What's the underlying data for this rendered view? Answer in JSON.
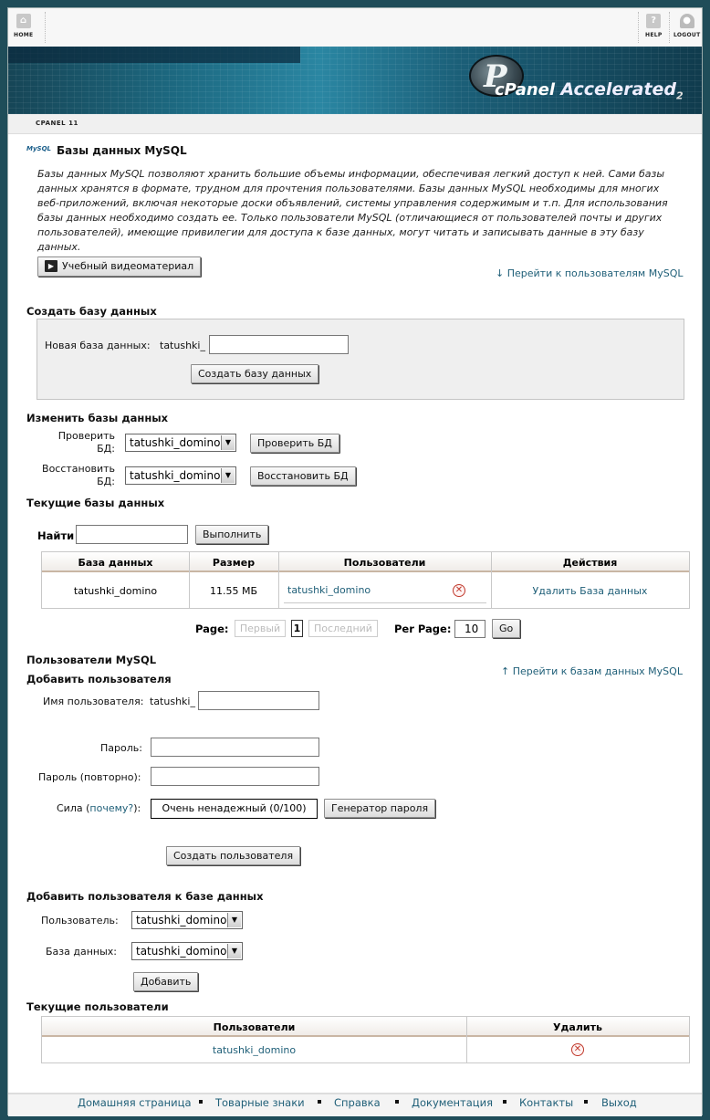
{
  "toolbar": {
    "home": "HOME",
    "help": "HELP",
    "logout": "LOGOUT"
  },
  "banner": {
    "logo_letter": "P",
    "brand": "cPanel",
    "brand_suffix": "Accelerated",
    "version": "2"
  },
  "breadcrumb": "CPANEL 11",
  "page": {
    "icon": "MySQL",
    "title": "Базы данных MySQL",
    "description_lines": [
      "Базы данных MySQL позволяют хранить большие объемы информации, обеспечивая легкий доступ к ней. Сами базы",
      "данных хранятся в формате, трудном для прочтения пользователями. Базы данных MySQL необходимы для многих",
      "веб-приложений, включая некоторые доски объявлений, системы управления содержимым и т.п. Для использования",
      "базы данных необходимо создать ее. Только пользователи MySQL (отличающиеся от пользователей почты и других",
      "пользователей), имеющие привилегии для доступа к базе данных, могут читать и записывать данные в эту базу",
      "данных."
    ],
    "video_button": "Учебный видеоматериал",
    "jump_users_link": "Перейти к пользователям MySQL"
  },
  "create_db": {
    "heading": "Создать базу данных",
    "label": "Новая база данных:",
    "prefix": "tatushki_",
    "value": "",
    "button": "Создать базу данных"
  },
  "modify_db": {
    "heading": "Изменить базы данных",
    "check_label_1": "Проверить",
    "check_label_2": "БД:",
    "check_select": "tatushki_domino",
    "check_button": "Проверить БД",
    "repair_label_1": "Восстановить",
    "repair_label_2": "БД:",
    "repair_select": "tatushki_domino",
    "repair_button": "Восстановить БД"
  },
  "current_db": {
    "heading": "Текущие базы данных",
    "search_label": "Найти",
    "search_value": "",
    "search_button": "Выполнить",
    "columns": [
      "База данных",
      "Размер",
      "Пользователи",
      "Действия"
    ],
    "rows": [
      {
        "database": "tatushki_domino",
        "size": "11.55 МБ",
        "user": "tatushki_domino",
        "action": "Удалить База данных"
      }
    ],
    "pagination": {
      "page_label": "Page:",
      "first": "Первый",
      "current": "1",
      "last": "Последний",
      "per_page_label": "Per Page:",
      "per_page": "10",
      "go": "Go"
    }
  },
  "mysql_users": {
    "heading": "Пользователи MySQL",
    "sub_heading": "Добавить пользователя",
    "jump_db_link": "Перейти к базам данных MySQL",
    "username_label": "Имя пользователя:",
    "username_prefix": "tatushki_",
    "password_label": "Пароль:",
    "password2_label": "Пароль (повторно):",
    "strength_label": "Сила",
    "strength_why": "почему?",
    "strength_value": "Очень ненадежный (0/100)",
    "generator_button": "Генератор пароля",
    "create_button": "Создать пользователя"
  },
  "add_user_db": {
    "heading": "Добавить пользователя к базе данных",
    "user_label": "Пользователь:",
    "user_select": "tatushki_domino",
    "db_label": "База данных:",
    "db_select": "tatushki_domino",
    "add_button": "Добавить"
  },
  "current_users": {
    "heading": "Текущие пользователи",
    "columns": [
      "Пользователи",
      "Удалить"
    ],
    "rows": [
      {
        "user": "tatushki_domino"
      }
    ]
  },
  "footer": {
    "links": [
      "Домашняя страница",
      "Товарные знаки",
      "Справка",
      "Документация",
      "Контакты",
      "Выход"
    ]
  }
}
